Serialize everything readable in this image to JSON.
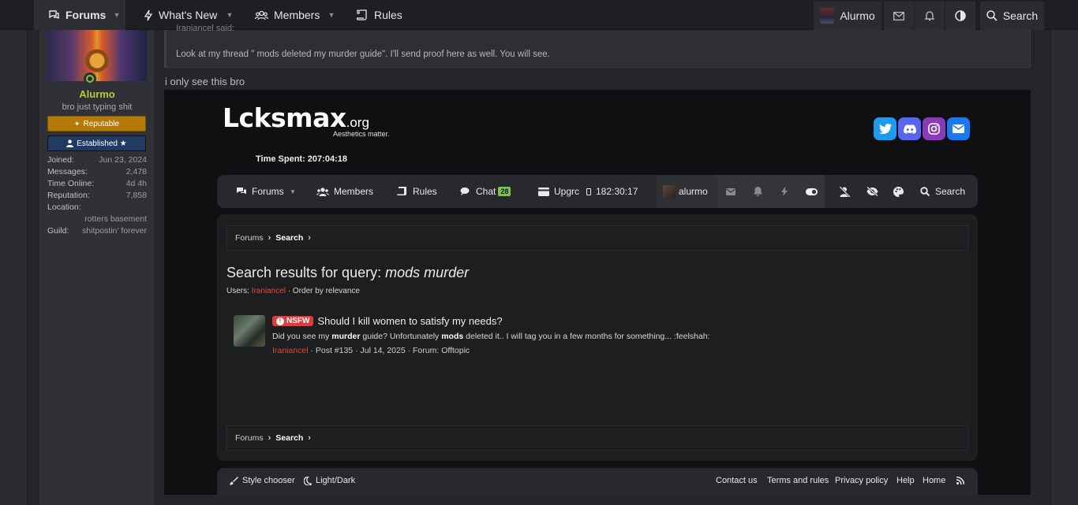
{
  "nav": {
    "forums": "Forums",
    "whats_new": "What's New",
    "members": "Members",
    "rules": "Rules",
    "user": "Alurmo",
    "search": "Search"
  },
  "sidebar": {
    "name": "Alurmo",
    "title": "bro just typing shit",
    "badge_reputable": "Reputable",
    "badge_established": "Established ★",
    "stats": [
      {
        "k": "Joined:",
        "v": "Jun 23, 2024"
      },
      {
        "k": "Messages:",
        "v": "2,478"
      },
      {
        "k": "Time Online:",
        "v": "4d 4h"
      },
      {
        "k": "Reputation:",
        "v": "7,858"
      }
    ],
    "location_label": "Location:",
    "location_value": "rotters basement",
    "guild_label": "Guild:",
    "guild_value": "shitpostin' forever"
  },
  "post": {
    "quote_head": "Iraniancel said:",
    "quote_text": "Look at my thread \" mods deleted my murder guide\". I'll send proof here as well. You will see.",
    "text": "i only see this bro"
  },
  "embedded": {
    "logo_main": "Lcksmax",
    "logo_org": ".org",
    "tagline": "Aesthetics matter.",
    "time_spent": "Time Spent: 207:04:18",
    "nav": {
      "forums": "Forums",
      "members": "Members",
      "rules": "Rules",
      "chat": "Chat",
      "chat_count": "28",
      "upgrade": "Upgrc",
      "timer": "182:30:17",
      "user": "alurmo",
      "search": "Search"
    },
    "breadcrumb": {
      "root": "Forums",
      "current": "Search"
    },
    "results_title_prefix": "Search results for query: ",
    "results_query": "mods murder",
    "meta_users": "Users: ",
    "meta_user": "Iraniancel",
    "meta_order": " · Order by relevance",
    "result": {
      "tag": "NSFW",
      "title": "Should I kill women to satisfy my needs?",
      "snip_1": "Did you see my ",
      "snip_b1": "murder",
      "snip_2": " guide? Unfortunately ",
      "snip_b2": "mods",
      "snip_3": " deleted it.. I will tag you in a few months for something... :feelshah:",
      "author": "Iraniancel",
      "footer": " · Post #135 · Jul 14, 2025 · Forum: Offtopic"
    },
    "footer": {
      "style": "Style chooser",
      "light_dark": "Light/Dark",
      "contact": "Contact us",
      "terms": "Terms and rules",
      "privacy": "Privacy policy",
      "help": "Help",
      "home": "Home"
    }
  },
  "colors": {
    "accent_green": "#b6c93a",
    "reputable": "#b57a06",
    "established": "#203a63",
    "nsfw": "#e33b3b",
    "user_red": "#e7483b"
  }
}
